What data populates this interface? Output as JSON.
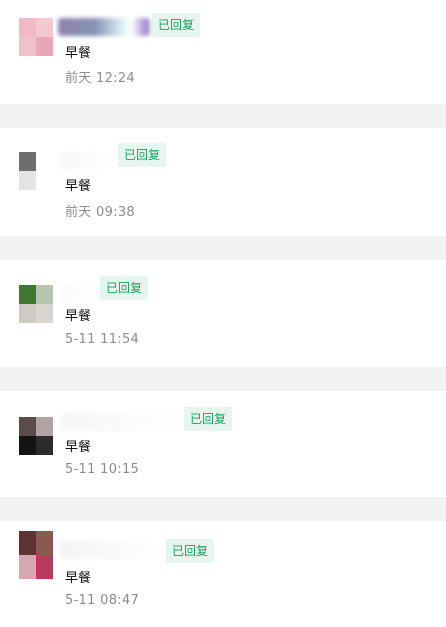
{
  "status_badge_color": "#1f9d5c",
  "items": [
    {
      "status": "已回复",
      "message": "早餐",
      "time": "前天 12:24",
      "avatar_colors": [
        "#f2b9c4",
        "#f4c8d0",
        "#f0c0cb",
        "#e8a7b6"
      ]
    },
    {
      "status": "已回复",
      "message": "早餐",
      "time": "前天 09:38",
      "avatar_colors": [
        "#6e6e6e",
        "#ffffff",
        "#e4e4e4",
        "#ffffff"
      ]
    },
    {
      "status": "已回复",
      "message": "早餐",
      "time": "5-11 11:54",
      "avatar_colors": [
        "#3f7a2c",
        "#b7c5b0",
        "#cfcbc2",
        "#d9d6cf"
      ]
    },
    {
      "status": "已回复",
      "message": "早餐",
      "time": "5-11 10:15",
      "avatar_colors": [
        "#5b4b4b",
        "#b3a3a6",
        "#141414",
        "#2b2b2b"
      ]
    },
    {
      "status": "已回复",
      "message": "早餐",
      "time": "5-11 08:47",
      "avatar_colors": [
        "#5e3333",
        "#8a5a4f",
        "#d6a6b1",
        "#b93a5b"
      ]
    }
  ]
}
